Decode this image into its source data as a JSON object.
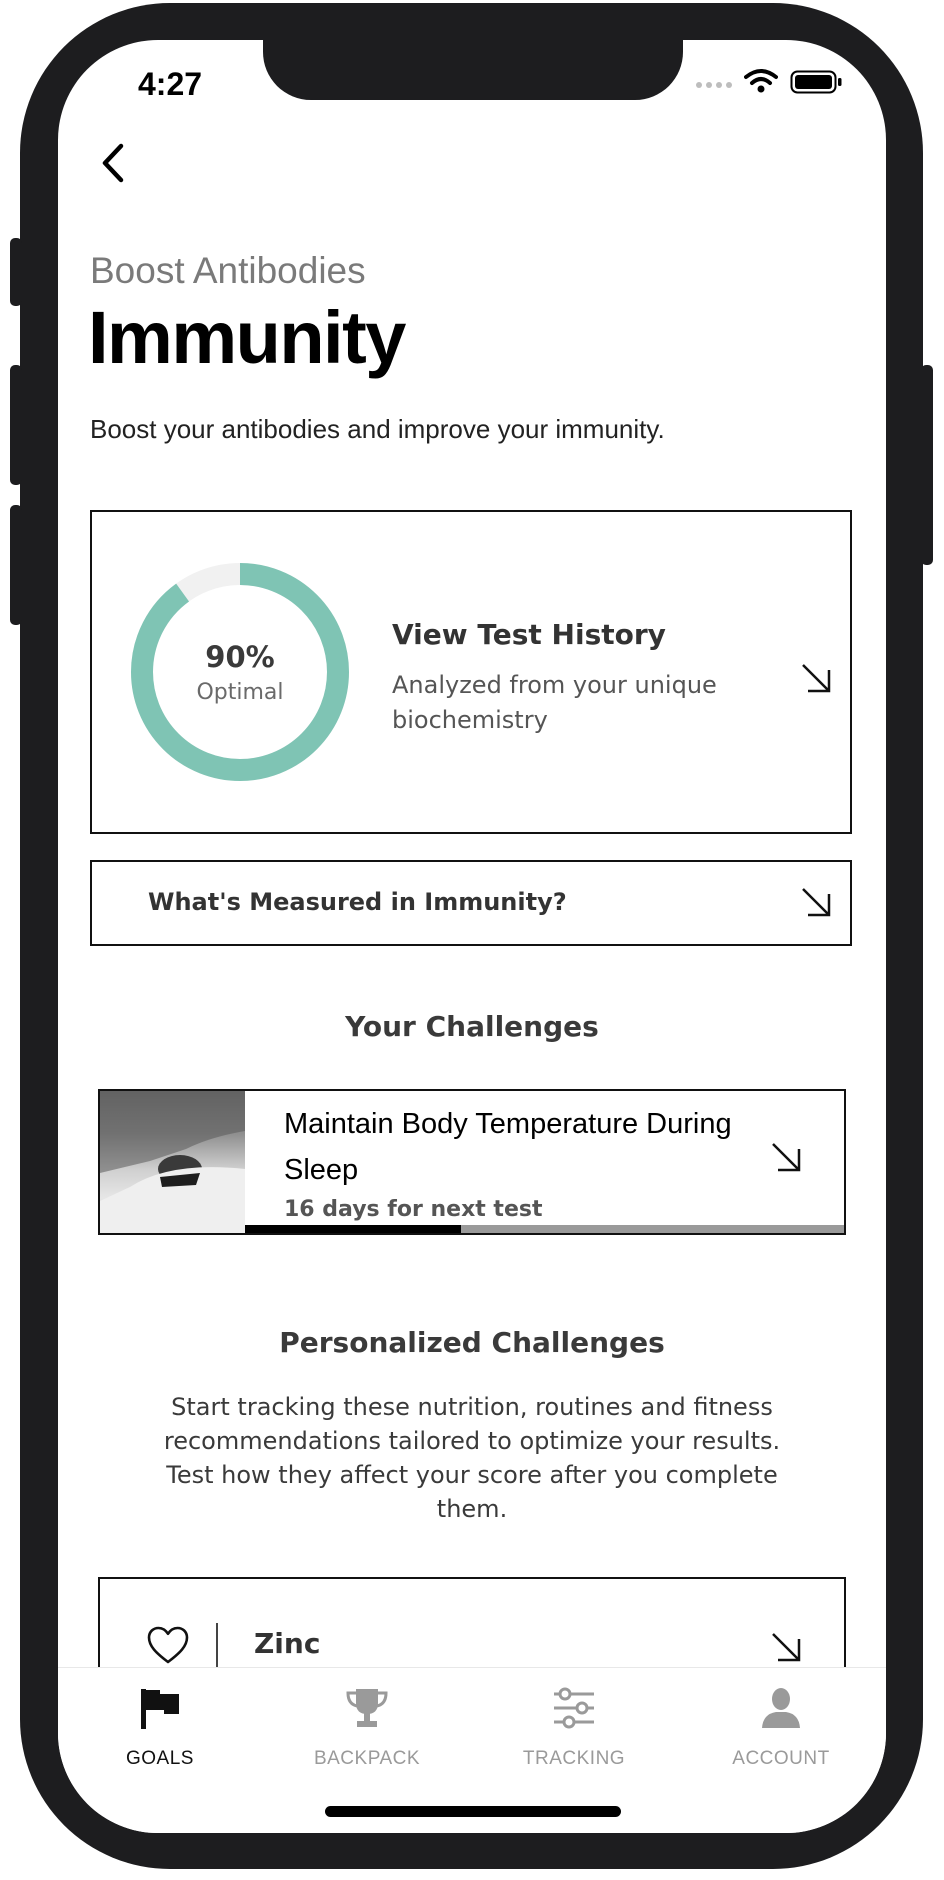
{
  "status_bar": {
    "time": "4:27"
  },
  "header": {
    "eyebrow": "Boost Antibodies",
    "title": "Immunity",
    "description": "Boost your antibodies and improve your immunity."
  },
  "score_card": {
    "percent_label": "90%",
    "percent_value": 0.9,
    "status": "Optimal",
    "link_title": "View Test History",
    "link_subtitle": "Analyzed from your unique biochemistry",
    "ring_color": "#7fc4b4",
    "ring_track_color": "#f1f1f1"
  },
  "measured_card": {
    "label": "What's Measured in Immunity?"
  },
  "your_challenges": {
    "heading": "Your Challenges",
    "items": [
      {
        "title": "Maintain Body Temperature During Sleep",
        "meta": "16 days for next test",
        "progress": 0.36
      }
    ]
  },
  "personalized": {
    "heading": "Personalized Challenges",
    "description": "Start tracking these nutrition, routines and fitness recommendations tailored to optimize your results. Test how they affect your score after you complete them.",
    "items": [
      {
        "label": "Zinc",
        "icon": "heart-outline-icon"
      }
    ]
  },
  "tabbar": {
    "tabs": [
      {
        "label": "GOALS",
        "icon": "flag-icon",
        "active": true
      },
      {
        "label": "BACKPACK",
        "icon": "trophy-icon",
        "active": false
      },
      {
        "label": "TRACKING",
        "icon": "sliders-icon",
        "active": false
      },
      {
        "label": "ACCOUNT",
        "icon": "person-icon",
        "active": false
      }
    ],
    "active_color": "#111111",
    "inactive_color": "#9a9a9a"
  }
}
